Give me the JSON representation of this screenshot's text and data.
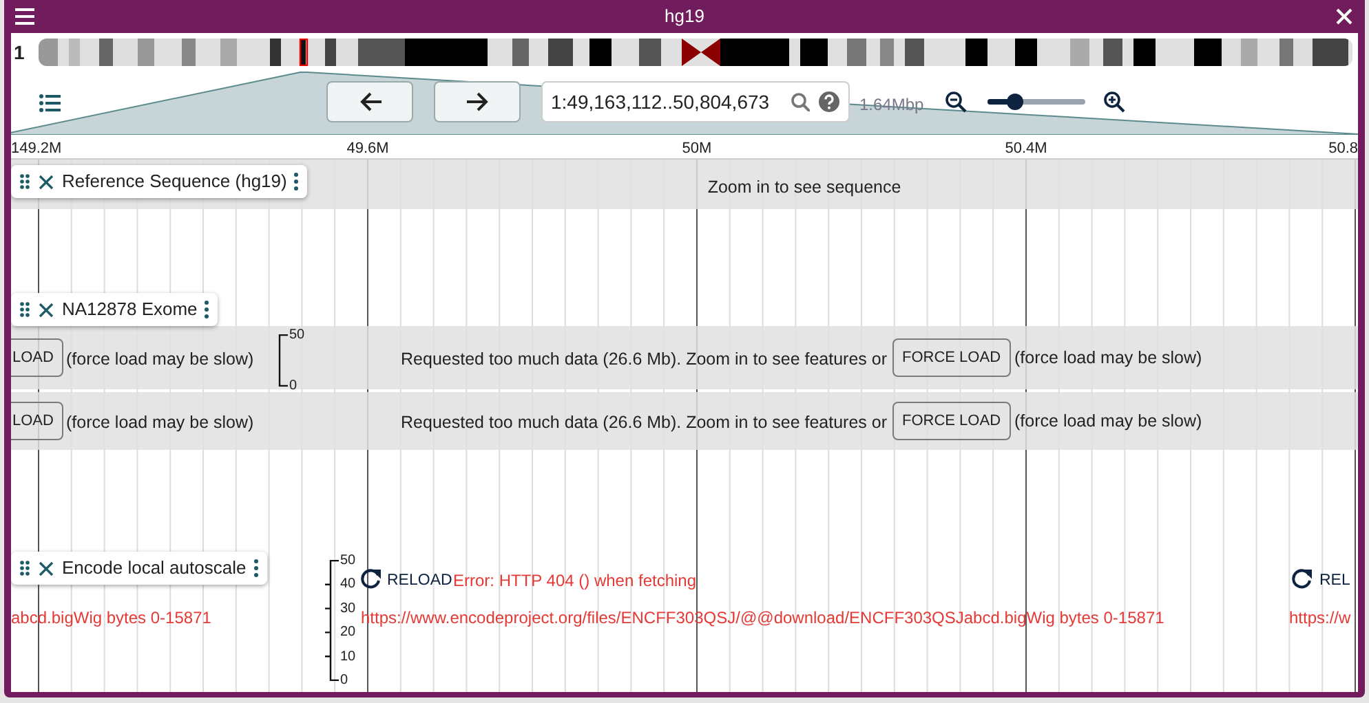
{
  "window": {
    "title": "hg19"
  },
  "chromosome": {
    "name": "1"
  },
  "toolbar": {
    "location": "1:49,163,112..50,804,673",
    "span": "1.64Mbp",
    "zoom": {
      "level": 0.28
    }
  },
  "ruler": {
    "ticks": [
      "149.2M",
      "49.6M",
      "50M",
      "50.4M",
      "50.8"
    ]
  },
  "tracks": [
    {
      "kind": "sequence",
      "name": "Reference Sequence (hg19)",
      "message": "Zoom in to see sequence"
    },
    {
      "kind": "toomuch",
      "name": "NA12878 Exome",
      "scale": [
        "50",
        "0"
      ],
      "rows": [
        {
          "left_button": "LOAD",
          "left_note": "(force load may be slow)",
          "message": "Requested too much data (26.6 Mb). Zoom in to see features or",
          "button": "FORCE LOAD",
          "note": "(force load may be slow)"
        },
        {
          "left_button": "LOAD",
          "left_note": "(force load may be slow)",
          "message": "Requested too much data (26.6 Mb). Zoom in to see features or",
          "button": "FORCE LOAD",
          "note": "(force load may be slow)"
        }
      ]
    },
    {
      "kind": "error",
      "name": "Encode local autoscale",
      "scale": [
        "50",
        "40",
        "30",
        "20",
        "10",
        "0"
      ],
      "left_text": "abcd.bigWig bytes 0-15871",
      "reload": "RELOAD",
      "error": "Error: HTTP 404 () when fetching",
      "url": "https://www.encodeproject.org/files/ENCFF303QSJ/@@download/ENCFF303QSJabcd.bigWig bytes 0-15871",
      "right_reload": "REL",
      "right_url": "https://w"
    }
  ]
}
